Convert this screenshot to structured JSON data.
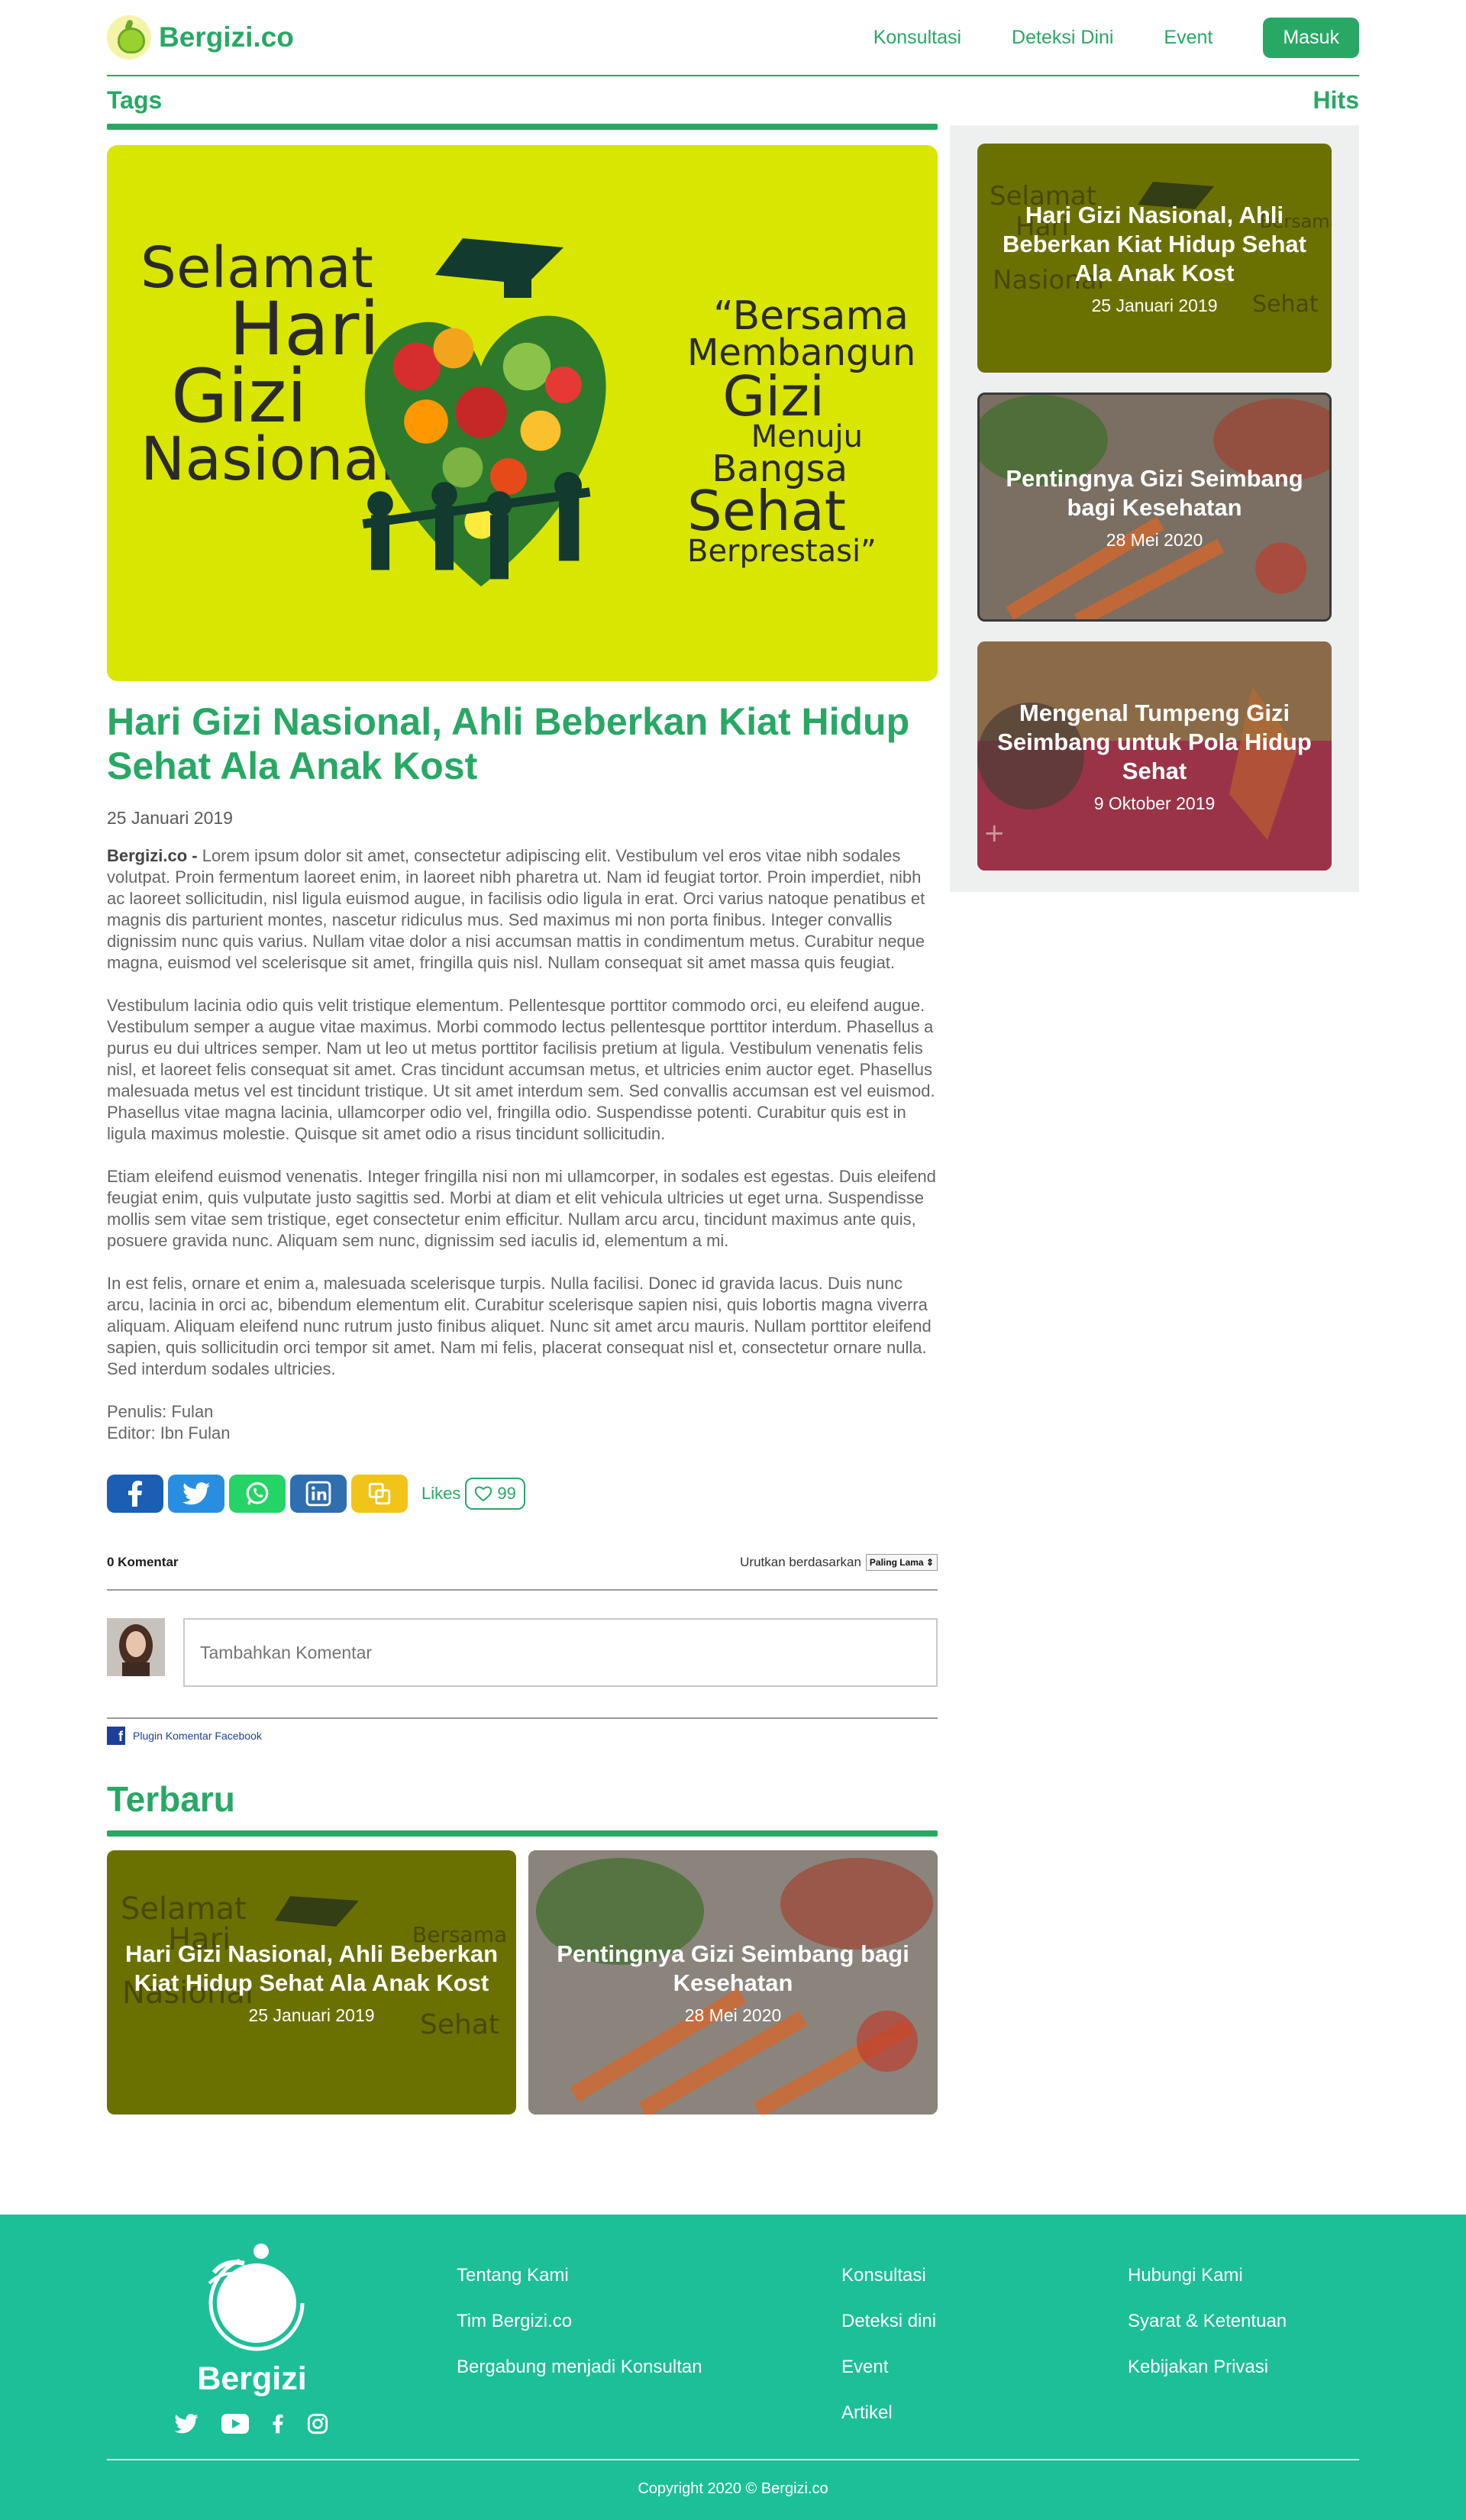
{
  "header": {
    "brand": "Bergizi.co",
    "nav": [
      "Konsultasi",
      "Deteksi Dini",
      "Event"
    ],
    "login": "Masuk"
  },
  "tags_label": "Tags",
  "hits_label": "Hits",
  "hero_image": {
    "lettering_left": [
      "Selamat",
      "Hari",
      "Gizi",
      "Nasional"
    ],
    "lettering_right": [
      "“Bersama",
      "Membangun",
      "Gizi",
      "Menuju",
      "Bangsa",
      "Sehat",
      "Berprestasi”"
    ]
  },
  "article": {
    "title": "Hari Gizi Nasional, Ahli Beberkan Kiat Hidup Sehat Ala Anak Kost",
    "date": "25 Januari 2019",
    "lead": "Bergizi.co -",
    "paragraphs": [
      "Lorem ipsum dolor sit amet, consectetur adipiscing elit. Vestibulum vel eros vitae nibh sodales volutpat. Proin fermentum laoreet enim, in laoreet nibh pharetra ut. Nam id feugiat tortor. Proin imperdiet, nibh ac laoreet sollicitudin, nisl ligula euismod augue, in facilisis odio ligula in erat. Orci varius natoque penatibus et magnis dis parturient montes, nascetur ridiculus mus. Sed maximus mi non porta finibus. Integer convallis dignissim nunc quis varius. Nullam vitae dolor a nisi accumsan mattis in condimentum metus. Curabitur neque magna, euismod vel scelerisque sit amet, fringilla quis nisl. Nullam consequat sit amet massa quis feugiat.",
      "Vestibulum lacinia odio quis velit tristique elementum. Pellentesque porttitor commodo orci, eu eleifend augue. Vestibulum semper a augue vitae maximus. Morbi commodo lectus pellentesque porttitor interdum. Phasellus a purus eu dui ultrices semper. Nam ut leo ut metus porttitor facilisis pretium at ligula. Vestibulum venenatis felis nisl, et laoreet felis consequat sit amet. Cras tincidunt accumsan metus, et ultricies enim auctor eget. Phasellus malesuada metus vel est tincidunt tristique. Ut sit amet interdum sem. Sed convallis accumsan est vel euismod. Phasellus vitae magna lacinia, ullamcorper odio vel, fringilla odio. Suspendisse potenti. Curabitur quis est in ligula maximus molestie. Quisque sit amet odio a risus tincidunt sollicitudin.",
      "Etiam eleifend euismod venenatis. Integer fringilla nisi non mi ullamcorper, in sodales est egestas. Duis eleifend feugiat enim, quis vulputate justo sagittis sed. Morbi at diam et elit vehicula ultricies ut eget urna. Suspendisse mollis sem vitae sem tristique, eget consectetur enim efficitur. Nullam arcu arcu, tincidunt maximus ante quis, posuere gravida nunc. Aliquam sem nunc, dignissim sed iaculis id, elementum a mi.",
      "In est felis, ornare et enim a, malesuada scelerisque turpis. Nulla facilisi. Donec id gravida lacus. Duis nunc arcu, lacinia in orci ac, bibendum elementum elit. Curabitur scelerisque sapien nisi, quis lobortis magna viverra aliquam. Aliquam eleifend nunc rutrum justo finibus aliquet. Nunc sit amet arcu mauris. Nullam porttitor eleifend sapien, quis sollicitudin orci tempor sit amet. Nam mi felis, placerat consequat nisl et, consectetur ornare nulla. Sed interdum sodales ultricies."
    ],
    "author": "Penulis: Fulan",
    "editor": "Editor: Ibn Fulan"
  },
  "share": {
    "likes_label": "Likes",
    "likes_count": "99"
  },
  "comments": {
    "count_label": "0 Komentar",
    "sort_label": "Urutkan berdasarkan",
    "sort_value": "Paling Lama",
    "placeholder": "Tambahkan Komentar",
    "plugin_label": "Plugin Komentar Facebook"
  },
  "hits": [
    {
      "title": "Hari Gizi Nasional, Ahli Beberkan Kiat Hidup Sehat Ala Anak Kost",
      "date": "25 Januari 2019",
      "color": "#6b7100"
    },
    {
      "title": "Pentingnya Gizi Seimbang bagi Kesehatan",
      "date": "28 Mei 2020",
      "color": "#6b5a44"
    },
    {
      "title": "Mengenal Tumpeng Gizi Seimbang untuk Pola Hidup Sehat",
      "date": "9 Oktober 2019",
      "color": "#8a3f4a"
    }
  ],
  "terbaru": {
    "title": "Terbaru",
    "items": [
      {
        "title": "Hari Gizi Nasional, Ahli Beberkan Kiat Hidup Sehat Ala Anak Kost",
        "date": "25 Januari 2019"
      },
      {
        "title": "Pentingnya Gizi Seimbang bagi Kesehatan",
        "date": "28 Mei 2020"
      }
    ]
  },
  "footer": {
    "brand": "Bergizi",
    "col1": [
      "Tentang Kami",
      "Tim Bergizi.co",
      "Bergabung menjadi Konsultan"
    ],
    "col2": [
      "Konsultasi",
      "Deteksi dini",
      "Event",
      "Artikel"
    ],
    "col3": [
      "Hubungi Kami",
      "Syarat & Ketentuan",
      "Kebijakan Privasi"
    ],
    "copyright": "Copyright 2020 © Bergizi.co",
    "social_icons": [
      "twitter-icon",
      "youtube-icon",
      "facebook-icon",
      "instagram-icon"
    ]
  },
  "colors": {
    "primary": "#28a865",
    "footer": "#1cbf98",
    "hero_bg": "#d8e600"
  }
}
